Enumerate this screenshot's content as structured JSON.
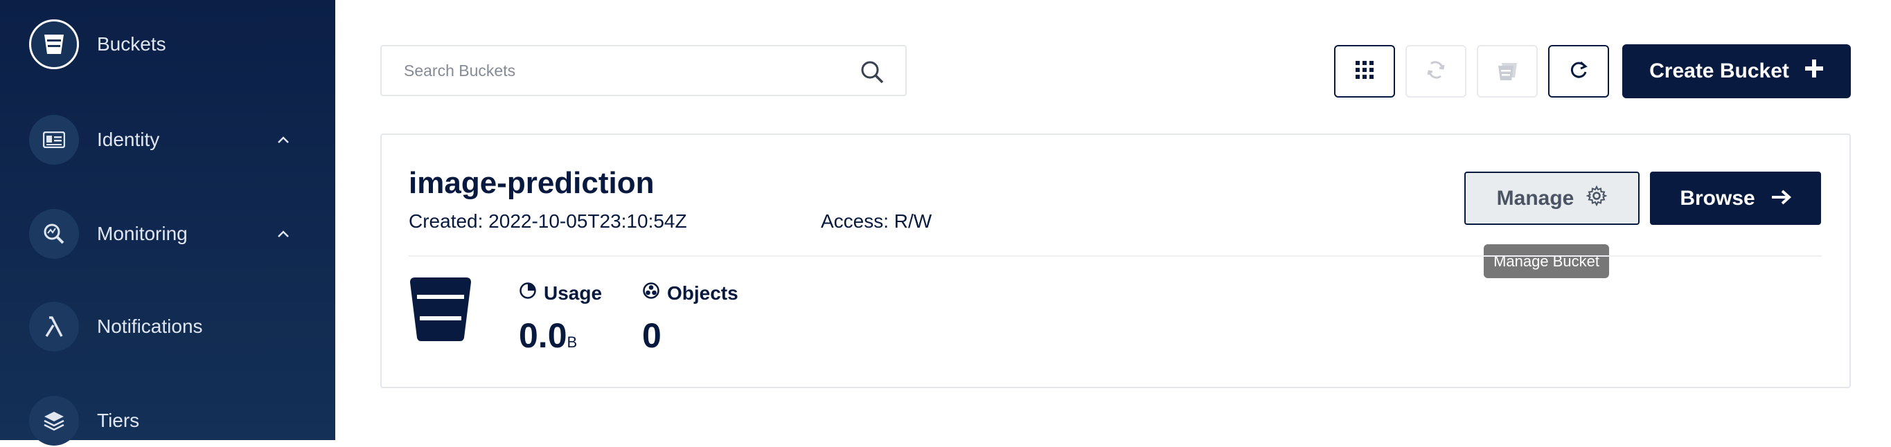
{
  "sidebar": {
    "items": [
      {
        "label": "Buckets",
        "icon": "bucket-icon",
        "active": true
      },
      {
        "label": "Identity",
        "icon": "id-card-icon",
        "caret": "^"
      },
      {
        "label": "Monitoring",
        "icon": "monitoring-icon",
        "caret": "^"
      },
      {
        "label": "Notifications",
        "icon": "lambda-icon"
      },
      {
        "label": "Tiers",
        "icon": "layers-icon"
      }
    ]
  },
  "toolbar": {
    "search_placeholder": "Search Buckets",
    "create_label": "Create Bucket"
  },
  "bucket": {
    "name": "image-prediction",
    "created": "Created: 2022-10-05T23:10:54Z",
    "access": "Access: R/W",
    "manage_label": "Manage",
    "browse_label": "Browse",
    "tooltip": "Manage Bucket",
    "usage_label": "Usage",
    "usage_value": "0.0",
    "usage_unit": "B",
    "objects_label": "Objects",
    "objects_value": "0"
  },
  "colors": {
    "sidebar_bg": "#0b1f47",
    "primary": "#081a3f",
    "tooltip_bg": "#777777"
  }
}
